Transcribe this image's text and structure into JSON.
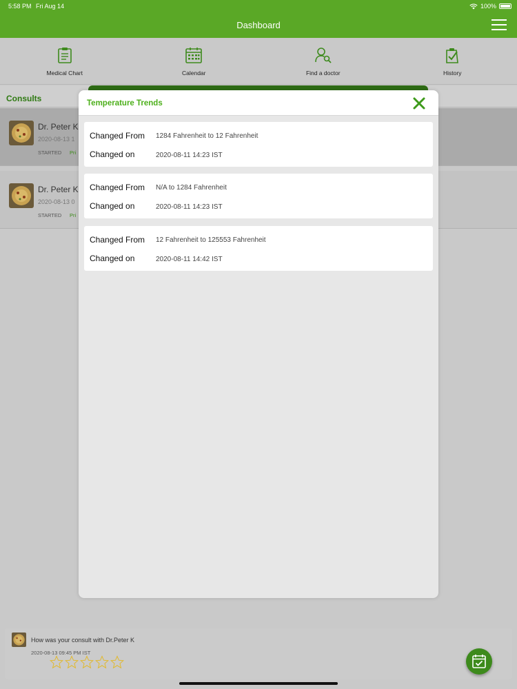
{
  "status_bar": {
    "time": "5:58 PM",
    "date": "Fri Aug 14",
    "battery": "100%"
  },
  "header": {
    "title": "Dashboard"
  },
  "nav": {
    "items": [
      {
        "label": "Medical Chart",
        "icon": "clipboard-icon"
      },
      {
        "label": "Calendar",
        "icon": "calendar-icon"
      },
      {
        "label": "Find a doctor",
        "icon": "find-doctor-icon"
      },
      {
        "label": "History",
        "icon": "history-icon"
      }
    ]
  },
  "consults": {
    "label": "Consults",
    "items": [
      {
        "name": "Dr. Peter K",
        "date": "2020-08-13 1",
        "state": "STARTED",
        "priority": "Pri"
      },
      {
        "name": "Dr. Peter K",
        "date": "2020-08-13 0",
        "state": "STARTED",
        "priority": "Pri"
      }
    ]
  },
  "modal": {
    "title": "Temperature Trends",
    "entries": [
      {
        "from_label": "Changed From",
        "from_value": "1284 Fahrenheit to 12 Fahrenheit",
        "on_label": "Changed on",
        "on_value": "2020-08-11 14:23 IST"
      },
      {
        "from_label": "Changed From",
        "from_value": "N/A to 1284 Fahrenheit",
        "on_label": "Changed on",
        "on_value": "2020-08-11 14:23 IST"
      },
      {
        "from_label": "Changed From",
        "from_value": "12 Fahrenheit to 125553 Fahrenheit",
        "on_label": "Changed on",
        "on_value": "2020-08-11 14:42 IST"
      }
    ]
  },
  "review": {
    "question": "How was your consult with Dr.Peter K",
    "date": "2020-08-13 09:45 PM IST",
    "stars_total": 5,
    "rating": 0
  },
  "colors": {
    "brand_green": "#5aa826",
    "title_green": "#4caf1a",
    "dark_green": "#2e6b14"
  }
}
